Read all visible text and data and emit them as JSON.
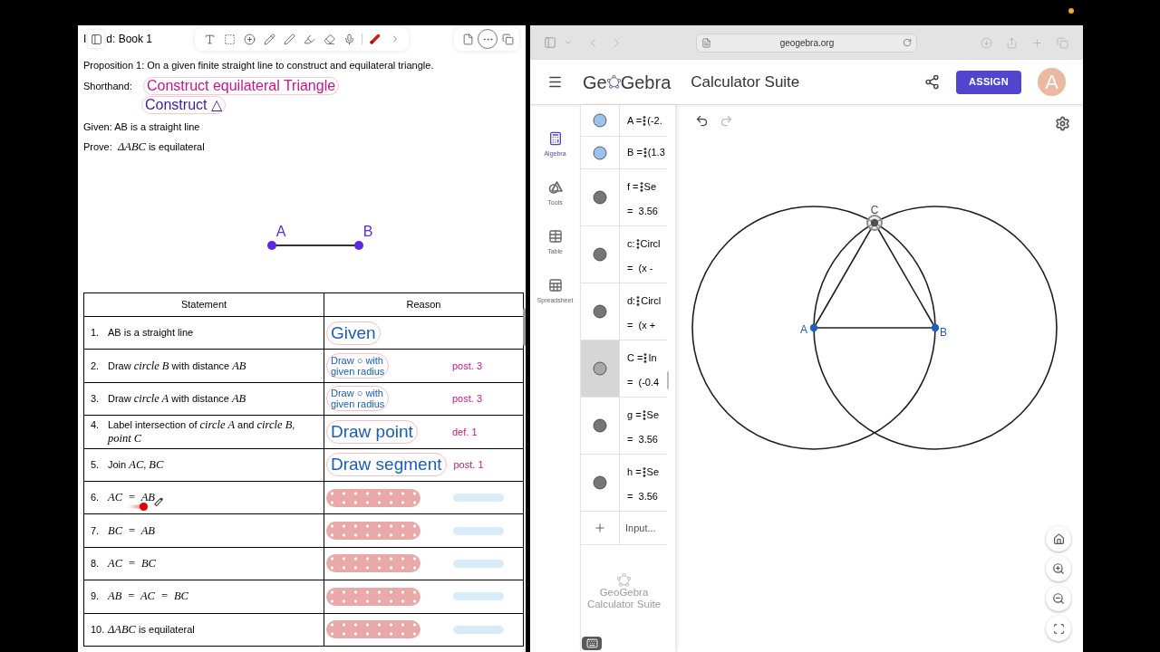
{
  "notes": {
    "title_fragment": "I",
    "title": "d: Book 1",
    "proposition": "Proposition 1: On a given finite straight line to construct and equilateral triangle.",
    "shorthand": {
      "label": "Shorthand:",
      "lines": [
        {
          "text": "Construct equilateral Triangle",
          "color": "#c4178a"
        },
        {
          "text": "Construct △",
          "color": "#3d1c9e"
        }
      ]
    },
    "given": "Given: AB is a straight line",
    "prove": "Prove:  *ΔABC* is equilateral",
    "figure": {
      "points": [
        {
          "label": "A"
        },
        {
          "label": "B"
        }
      ]
    },
    "table": {
      "columns": [
        "Statement",
        "Reason"
      ],
      "rows": [
        {
          "number": "1.",
          "kind": "text",
          "statement": "AB is a straight line",
          "pointer": false,
          "reason": {
            "kind": "written",
            "lines": [
              "Given"
            ]
          }
        },
        {
          "number": "2.",
          "kind": "text",
          "statement": "Draw *circle B* with distance *AB*",
          "pointer": false,
          "reason": {
            "kind": "written",
            "lines": [
              "Draw ○ with",
              "given radius"
            ],
            "note": "post. 3"
          }
        },
        {
          "number": "3.",
          "kind": "text",
          "statement": "Draw *circle A* with distance *AB*",
          "pointer": false,
          "reason": {
            "kind": "written",
            "lines": [
              "Draw ○ with",
              "given radius"
            ],
            "note": "post. 3"
          }
        },
        {
          "number": "4.",
          "kind": "text",
          "statement": "Label intersection of *circle A* and *circle B*, *point C*",
          "pointer": false,
          "reason": {
            "kind": "written",
            "lines": [
              "Draw point"
            ],
            "note": "def. 1"
          }
        },
        {
          "number": "5.",
          "kind": "text",
          "statement": "Join *AC*, *BC*",
          "pointer": false,
          "reason": {
            "kind": "written",
            "lines": [
              "Draw segment"
            ],
            "note": "post. 1"
          }
        },
        {
          "number": "6.",
          "kind": "math",
          "statement": "AC = AB",
          "pointer": true,
          "reason": {
            "kind": "covered"
          }
        },
        {
          "number": "7.",
          "kind": "math",
          "statement": "BC = AB",
          "pointer": false,
          "reason": {
            "kind": "covered"
          }
        },
        {
          "number": "8.",
          "kind": "math",
          "statement": "AC = BC",
          "pointer": false,
          "reason": {
            "kind": "covered"
          }
        },
        {
          "number": "9.",
          "kind": "math",
          "statement": "AB = AC = BC",
          "pointer": false,
          "reason": {
            "kind": "covered"
          }
        },
        {
          "number": "10.",
          "kind": "text",
          "statement": "*ΔABC* is equilateral",
          "pointer": false,
          "reason": {
            "kind": "covered"
          }
        }
      ]
    }
  },
  "browser": {
    "address": "geogebra.org"
  },
  "geogebra": {
    "brand_start": "Ge",
    "brand_end": "Gebra",
    "title": "Calculator Suite",
    "assign": "ASSIGN",
    "avatar": "A",
    "nav": [
      {
        "label": "Algebra",
        "selected": true
      },
      {
        "label": "Tools",
        "selected": false
      },
      {
        "label": "Table",
        "selected": false
      },
      {
        "label": "Spreadsheet",
        "selected": false
      }
    ],
    "algebra": [
      {
        "name": "A =",
        "definition": "(-2.",
        "color": "#9cc1ec",
        "selected": false
      },
      {
        "name": "B =",
        "definition": "(1.3",
        "color": "#9cc1ec",
        "selected": false
      },
      {
        "name": "f =",
        "definition": "Se",
        "value": "= 3.56",
        "color": "#767676",
        "selected": false
      },
      {
        "name": "c:",
        "definition": "Circl",
        "value": "= (x -",
        "color": "#767676",
        "selected": false
      },
      {
        "name": "d:",
        "definition": "Circl",
        "value": "= (x +",
        "color": "#767676",
        "selected": false
      },
      {
        "name": "C =",
        "definition": "In",
        "value": "= (-0.4",
        "color": "#a8a8a8",
        "selected": true
      },
      {
        "name": "g =",
        "definition": "Se",
        "value": "= 3.56",
        "color": "#767676",
        "selected": false
      },
      {
        "name": "h =",
        "definition": "Se",
        "value": "= 3.56",
        "color": "#767676",
        "selected": false
      }
    ],
    "input_placeholder": "Input...",
    "footer": [
      "GeoGebra",
      "Calculator Suite"
    ],
    "graphics": {
      "points": [
        {
          "label": "A",
          "color": "#1f5fb8",
          "selected": false
        },
        {
          "label": "B",
          "color": "#1f5fb8",
          "selected": false
        },
        {
          "label": "C",
          "color": "#505050",
          "selected": true
        }
      ]
    }
  }
}
